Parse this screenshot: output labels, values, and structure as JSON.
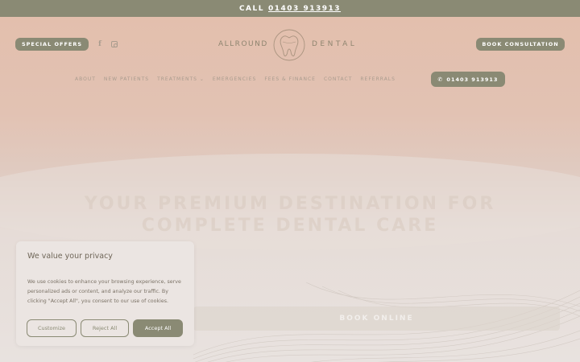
{
  "topbar": {
    "call_label": "CALL",
    "phone": "01403 913913"
  },
  "header": {
    "special_offers": "SPECIAL OFFERS",
    "book_consultation": "BOOK CONSULTATION",
    "logo_left": "ALLROUND",
    "logo_right": "DENTAL",
    "social_icons": [
      "facebook-icon",
      "instagram-icon"
    ]
  },
  "nav": {
    "items": [
      "ABOUT",
      "NEW PATIENTS",
      "TREATMENTS ⌄",
      "EMERGENCIES",
      "FEES & FINANCE",
      "CONTACT",
      "REFERRALS"
    ],
    "phone_button": "01403 913913"
  },
  "hero": {
    "headline_1": "YOUR PREMIUM DESTINATION FOR",
    "headline_2": "COMPLETE DENTAL CARE",
    "book_online": "BOOK ONLINE"
  },
  "cookie": {
    "title": "We value your privacy",
    "text": "We use cookies to enhance your browsing experience, serve personalized ads or content, and analyze our traffic. By clicking \"Accept All\", you consent to our use of cookies.",
    "customize": "Customize",
    "reject": "Reject All",
    "accept": "Accept All"
  },
  "colors": {
    "accent": "#8a8a74",
    "hero_top": "#e3bfad",
    "background": "#e8e2df"
  }
}
